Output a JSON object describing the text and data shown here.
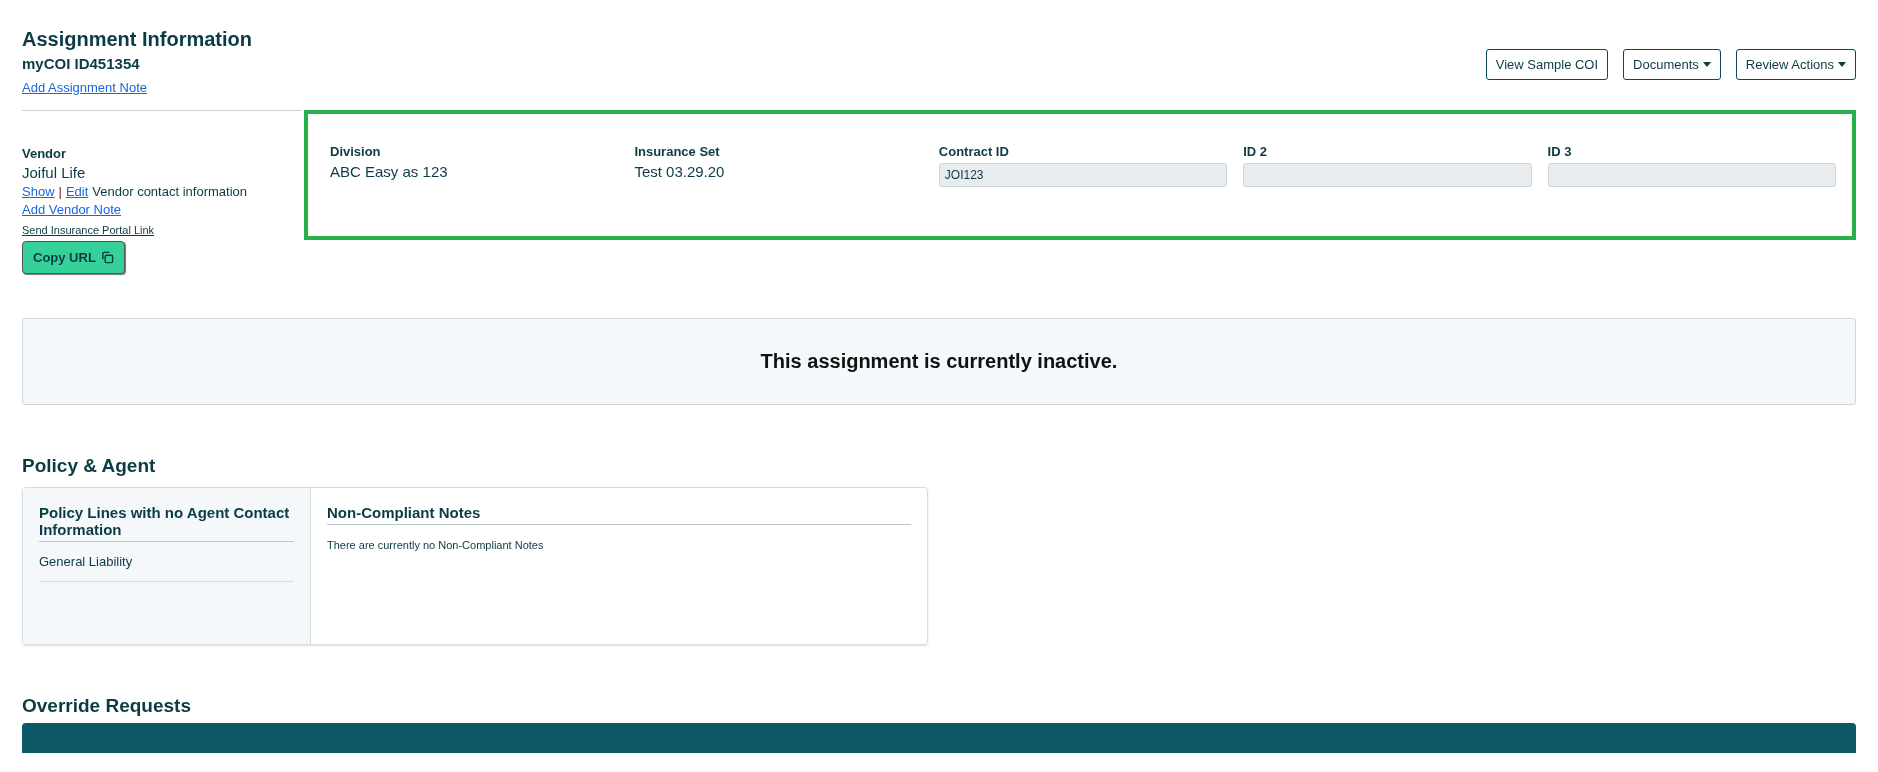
{
  "header": {
    "title": "Assignment Information",
    "subtitle": "myCOI ID451354",
    "note_link": "Add Assignment Note"
  },
  "actions": [
    {
      "label": "View Sample COI",
      "kind": "button"
    },
    {
      "label": "Documents",
      "kind": "dropdown"
    },
    {
      "label": "Review Actions",
      "kind": "dropdown"
    }
  ],
  "vendor": {
    "label": "Vendor",
    "name": "Joiful Life",
    "show_link": "Show",
    "separator": "|",
    "edit_link": "Edit",
    "contact_text": "Vendor contact information",
    "note_link": "Add Vendor Note",
    "portal_link": "Send Insurance Portal Link",
    "copy_button": "Copy URL"
  },
  "details": [
    {
      "label": "Division",
      "value": "ABC Easy as 123",
      "kind": "text"
    },
    {
      "label": "Insurance Set",
      "value": "Test 03.29.20",
      "kind": "text"
    },
    {
      "label": "Contract ID",
      "value": "JOI123",
      "kind": "field"
    },
    {
      "label": "ID 2",
      "kind": "field"
    },
    {
      "label": "ID 3",
      "kind": "field"
    }
  ],
  "status_banner": "This assignment is currently inactive.",
  "policy_agent": {
    "title": "Policy & Agent",
    "lines_title": "Policy Lines with no Agent Contact Information",
    "lines": [
      "General Liability"
    ],
    "notes_title": "Non-Compliant Notes",
    "notes_empty": "There are currently no Non-Compliant Notes"
  },
  "override_requests": {
    "title": "Override Requests"
  }
}
